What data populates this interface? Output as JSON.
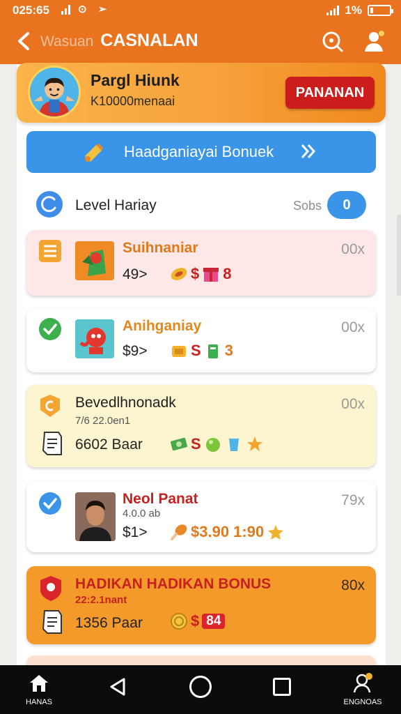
{
  "status_bar": {
    "time": "025:65",
    "battery": "1%"
  },
  "app_bar": {
    "subtitle": "Wasuan",
    "title": "CASNALAN"
  },
  "profile": {
    "name": "Pargl Hiunk",
    "subtitle": "K10000menaai",
    "button": "PANANAN"
  },
  "banner": {
    "text": "Haadganiayai Bonuek"
  },
  "level": {
    "label": "Level Hariay",
    "tag": "Sobs",
    "count": "0"
  },
  "cards": [
    {
      "title": "Suihnaniar",
      "price": "49>",
      "reward": "$",
      "reward2": "8",
      "badge": "00x",
      "bg": "#fde7e7",
      "title_color": "#e07a1e"
    },
    {
      "title": "Anihganiay",
      "price": "$9>",
      "reward": "S",
      "reward2": "3",
      "badge": "00x",
      "bg": "#ffffff",
      "title_color": "#e08a1e"
    },
    {
      "title": "Bevedlhnonadk",
      "sub": "7/6 22.0en1",
      "price": "6602 Baar",
      "reward": "S",
      "badge": "00x",
      "bg": "#fdf5cf",
      "title_color": "#1e1e1e"
    },
    {
      "title": "Neol Panat",
      "sub": "4.0.0 ab",
      "price": "$1>",
      "reward": "$3.90 1:90",
      "badge": "79x",
      "bg": "#ffffff",
      "title_color": "#c81f1f"
    },
    {
      "title": "HADIKAN HADIKAN BONUS",
      "sub": "22:2.1nant",
      "price": "1356 Paar",
      "reward": "$",
      "reward2": "84",
      "badge": "80x",
      "bg": "#f39a2a",
      "title_color": "#c81f1f"
    }
  ],
  "bottom_nav": {
    "home_label": "HANAS",
    "profile_label": "ENGNOAS"
  },
  "colors": {
    "primary": "#e9731f",
    "blue": "#3a94e8",
    "red": "#cc1d1d"
  }
}
